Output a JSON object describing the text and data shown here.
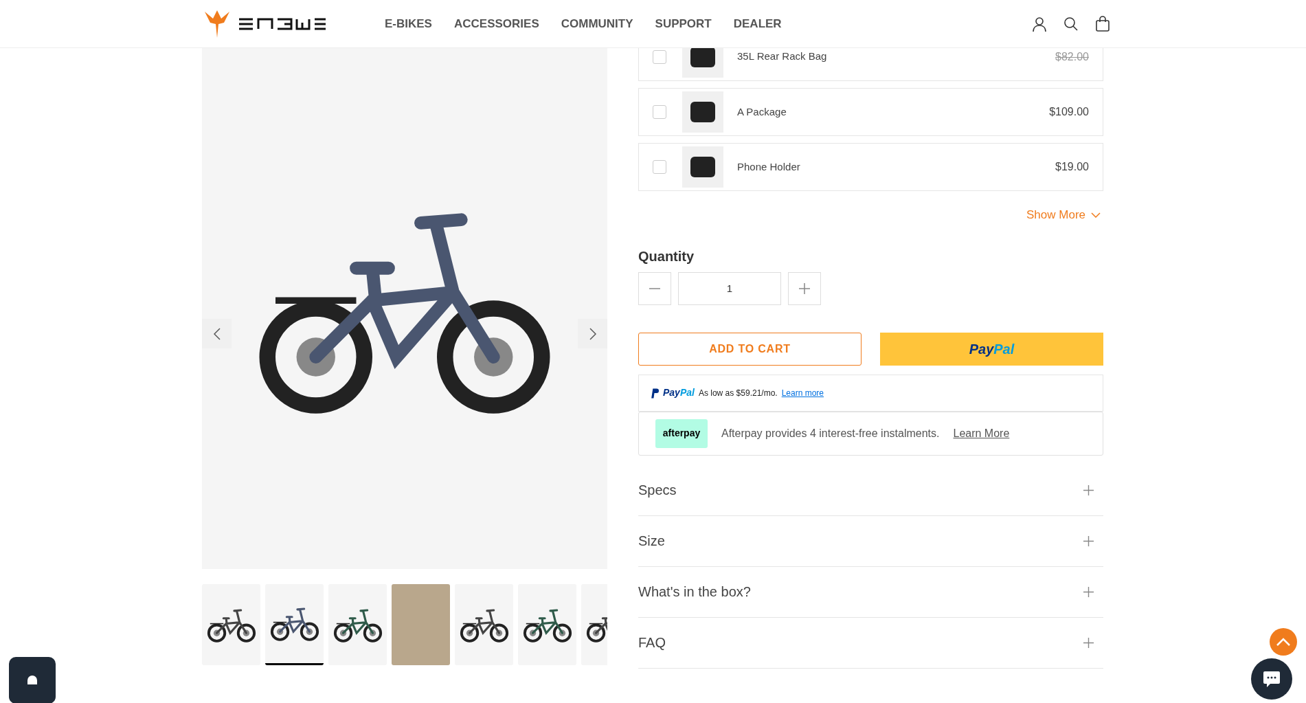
{
  "header": {
    "nav": [
      "E-BIKES",
      "ACCESSORIES",
      "COMMUNITY",
      "SUPPORT",
      "DEALER"
    ]
  },
  "gallery": {
    "thumbnails": [
      {
        "kind": "product",
        "selected": false
      },
      {
        "kind": "product",
        "selected": true
      },
      {
        "kind": "product",
        "selected": false
      },
      {
        "kind": "photo",
        "selected": false
      },
      {
        "kind": "product",
        "selected": false
      },
      {
        "kind": "product",
        "selected": false
      },
      {
        "kind": "product",
        "selected": false
      }
    ]
  },
  "addons": [
    {
      "name": "35L Rear Rack Bag",
      "old_price": "$82.00",
      "checked": false
    },
    {
      "name": "A Package",
      "price": "$109.00",
      "checked": false
    },
    {
      "name": "Phone Holder",
      "price": "$19.00",
      "checked": false
    }
  ],
  "show_more": "Show More",
  "quantity": {
    "label": "Quantity",
    "value": "1"
  },
  "add_to_cart": "ADD TO CART",
  "paypal_button": {
    "pay": "Pay",
    "pal": "Pal"
  },
  "paypal_message": {
    "pay": "Pay",
    "pal": "Pal",
    "text": "As low as $59.21/mo.",
    "link": "Learn more"
  },
  "afterpay": {
    "logo": "afterpay",
    "text": "Afterpay provides 4 interest-free instalments.",
    "link": "Learn More"
  },
  "accordion": [
    {
      "title": "Specs",
      "expanded": false
    },
    {
      "title": "Size",
      "expanded": false
    },
    {
      "title": "What's in the box?",
      "expanded": false
    },
    {
      "title": "FAQ",
      "expanded": false
    }
  ]
}
